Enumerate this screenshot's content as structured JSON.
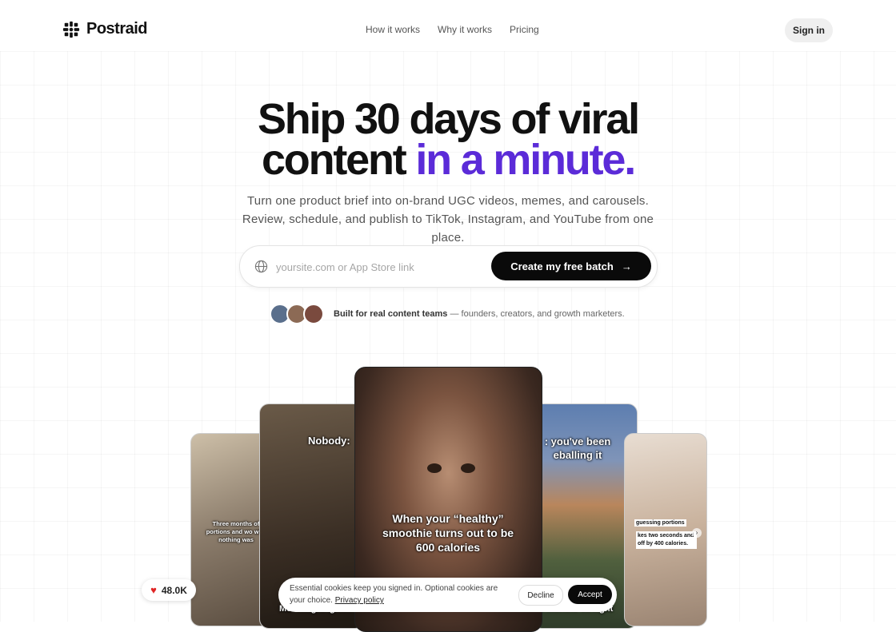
{
  "header": {
    "logo_text": "Postraid",
    "nav": [
      "How it works",
      "Why it works",
      "Pricing"
    ],
    "signin_label": "Sign in"
  },
  "hero": {
    "title_line1": "Ship 30 days of viral",
    "title_line2_plain": "content",
    "title_line2_accent": "in a minute.",
    "subtitle": "Turn one product brief into on-brand UGC videos, memes, and carousels. Review, schedule, and publish to TikTok, Instagram, and YouTube from one place.",
    "accent_color": "#5b2bd8"
  },
  "search": {
    "placeholder": "yoursite.com or App Store link",
    "value": "",
    "cta_label": "Create my free batch",
    "cta_icon": "arrow-right-icon"
  },
  "social_proof": {
    "strong": "Built for real content teams",
    "rest": " — founders, creators, and growth marketers."
  },
  "phones": {
    "p1_caption": "Three months of portions and wo why nothing was",
    "p2_caption_top": "Nobody:",
    "p2_caption_bottom": "Me: weighing rice",
    "p3_caption": "When your “healthy” smoothie turns out to be 600 calories",
    "p4_caption_top": ": you've been eballing it",
    "p4_caption_bottom": "6 months straight",
    "p5_caption_a": "guessing portions",
    "p5_caption_b": "kes two seconds and off by 400 calories."
  },
  "likes": {
    "count": "48.0K",
    "icon": "heart-icon"
  },
  "cookie": {
    "text": "Essential cookies keep you signed in. Optional cookies are your choice.",
    "link": "Privacy policy",
    "decline_label": "Decline",
    "accept_label": "Accept"
  }
}
